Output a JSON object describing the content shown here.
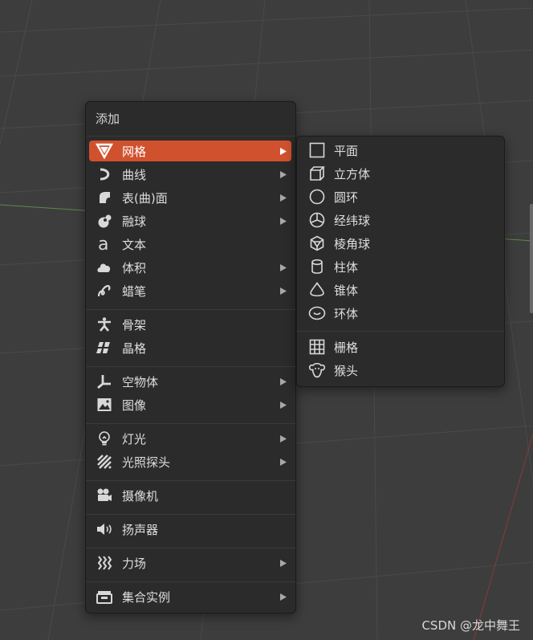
{
  "menu": {
    "title": "添加",
    "items": [
      {
        "label": "网格",
        "icon": "mesh-icon",
        "submenu": true,
        "active": true
      },
      {
        "label": "曲线",
        "icon": "curve-icon",
        "submenu": true
      },
      {
        "label": "表(曲)面",
        "icon": "surface-icon",
        "submenu": true
      },
      {
        "label": "融球",
        "icon": "metaball-icon",
        "submenu": true
      },
      {
        "label": "文本",
        "icon": "text-icon",
        "submenu": false
      },
      {
        "label": "体积",
        "icon": "volume-icon",
        "submenu": true
      },
      {
        "label": "蜡笔",
        "icon": "grease-pencil-icon",
        "submenu": true
      },
      {
        "label": "骨架",
        "icon": "armature-icon",
        "submenu": false
      },
      {
        "label": "晶格",
        "icon": "lattice-icon",
        "submenu": false
      },
      {
        "label": "空物体",
        "icon": "empty-icon",
        "submenu": true
      },
      {
        "label": "图像",
        "icon": "image-icon",
        "submenu": true
      },
      {
        "label": "灯光",
        "icon": "light-icon",
        "submenu": true
      },
      {
        "label": "光照探头",
        "icon": "light-probe-icon",
        "submenu": true
      },
      {
        "label": "摄像机",
        "icon": "camera-icon",
        "submenu": false
      },
      {
        "label": "扬声器",
        "icon": "speaker-icon",
        "submenu": false
      },
      {
        "label": "力场",
        "icon": "force-field-icon",
        "submenu": true
      },
      {
        "label": "集合实例",
        "icon": "collection-instance-icon",
        "submenu": true
      }
    ]
  },
  "submenu": {
    "items": [
      {
        "label": "平面",
        "icon": "plane-icon"
      },
      {
        "label": "立方体",
        "icon": "cube-icon"
      },
      {
        "label": "圆环",
        "icon": "circle-icon"
      },
      {
        "label": "经纬球",
        "icon": "uv-sphere-icon"
      },
      {
        "label": "棱角球",
        "icon": "ico-sphere-icon"
      },
      {
        "label": "柱体",
        "icon": "cylinder-icon"
      },
      {
        "label": "锥体",
        "icon": "cone-icon"
      },
      {
        "label": "环体",
        "icon": "torus-icon"
      },
      {
        "label": "栅格",
        "icon": "grid-icon"
      },
      {
        "label": "猴头",
        "icon": "monkey-icon"
      }
    ]
  },
  "watermark": "CSDN @龙中舞王",
  "colors": {
    "accent": "#d0512e",
    "menu_bg": "#2b2b2b",
    "viewport_bg": "#3d3d3d"
  }
}
